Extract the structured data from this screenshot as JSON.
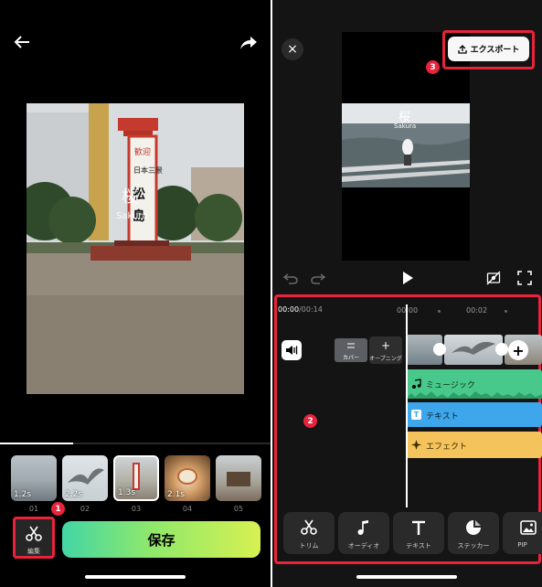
{
  "left": {
    "thumbnails": [
      {
        "duration": "1.2s",
        "index": "01"
      },
      {
        "duration": "2.2s",
        "index": "02"
      },
      {
        "duration": "1.3s",
        "index": "03"
      },
      {
        "duration": "2.1s",
        "index": "04"
      },
      {
        "duration": "",
        "index": "05"
      }
    ],
    "selected_thumbnail": "03",
    "photo_overlay": {
      "kanji": "桜",
      "romaji": "Sakura"
    },
    "edit_label": "編集",
    "save_label": "保存",
    "playback_progress": 0.27,
    "icons": [
      "back-arrow-icon",
      "share-arrow-icon",
      "scissors-icon"
    ]
  },
  "right": {
    "close_symbol": "×",
    "export_label": "エクスポート",
    "preview_overlay": {
      "kanji": "桜",
      "romaji": "Sakura"
    },
    "time": {
      "current": "00:00",
      "total": "/00:14"
    },
    "ticks": [
      "00:00",
      "00:02"
    ],
    "cover_label": "カバー",
    "opening_label": "オープニング",
    "tracks": {
      "music": "ミュージック",
      "text": "テキスト",
      "effect": "エフェクト"
    },
    "tools": [
      "トリム",
      "オーディオ",
      "テキスト",
      "ステッカー",
      "PIP"
    ],
    "colors": {
      "music": "#48c98b",
      "text": "#3ea7ec",
      "effect": "#f5c35c",
      "highlight": "#e8233b"
    }
  },
  "badges": [
    "1",
    "2",
    "3"
  ]
}
